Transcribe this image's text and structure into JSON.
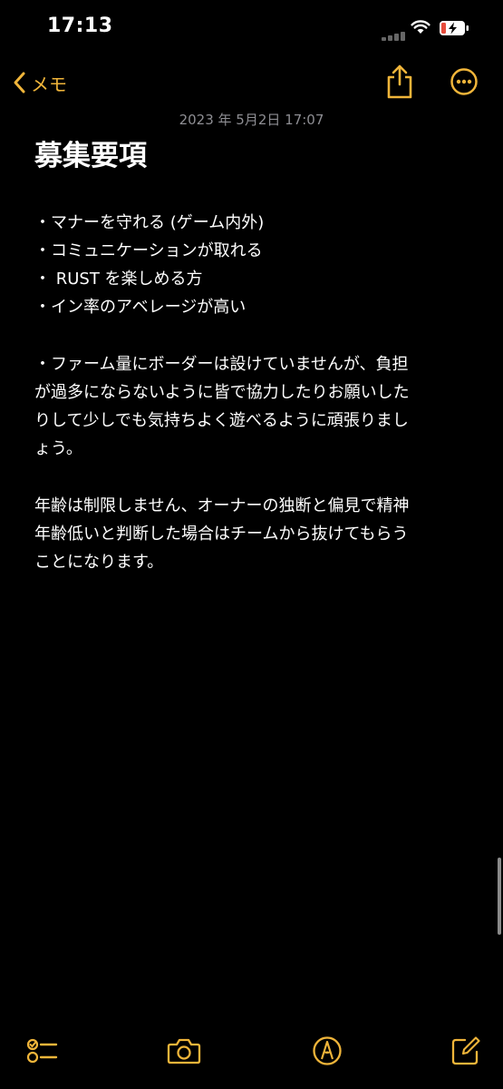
{
  "status_bar": {
    "time": "17:13"
  },
  "nav": {
    "back_label": "メモ",
    "share_icon": "share-icon",
    "more_icon": "ellipsis-circle-icon"
  },
  "note": {
    "date": "2023 年 5月2日 17:07",
    "title": "募集要項",
    "lines": [
      "・マナーを守れる (ゲーム内外)",
      "・コミュニケーションが取れる",
      "・ RUST を楽しめる方",
      "・イン率のアベレージが高い",
      "・ファーム量にボーダーは設けていませんが、負担",
      "が過多にならないように皆で協力したりお願いした",
      "りして少しでも気持ちよく遊べるように頑張りまし",
      "ょう。",
      "年齢は制限しません、オーナーの独断と偏見で精神",
      "年齢低いと判断した場合はチームから抜けてもらう",
      "ことになります。"
    ]
  },
  "toolbar": {
    "checklist_icon": "checklist-icon",
    "camera_icon": "camera-icon",
    "markup_icon": "markup-pen-icon",
    "compose_icon": "compose-icon"
  },
  "colors": {
    "accent": "#f0b53a",
    "background": "#000000",
    "secondary_text": "#8e8e93"
  }
}
